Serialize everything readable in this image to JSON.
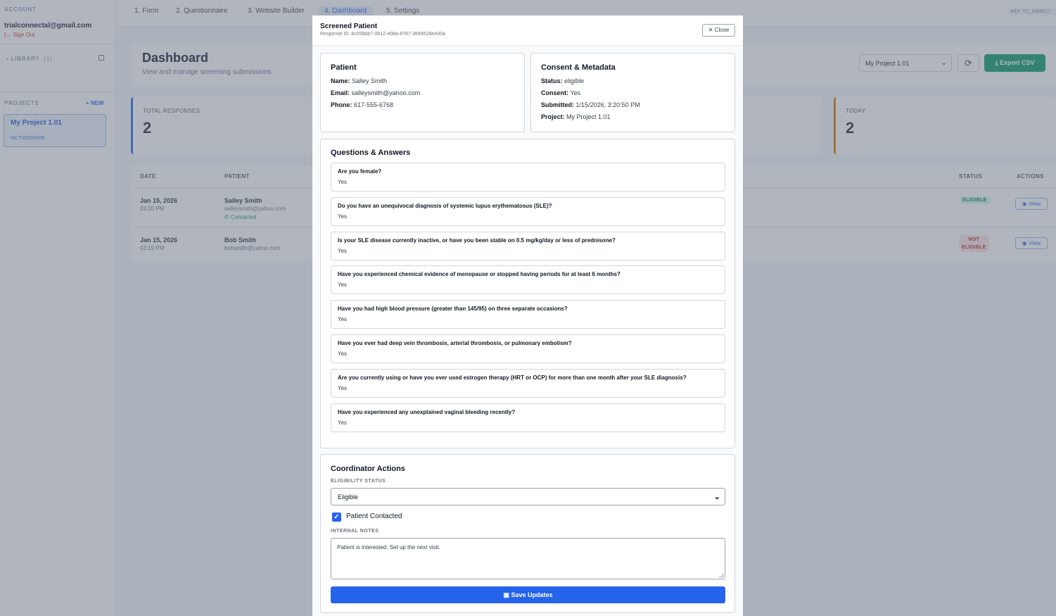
{
  "sidebar": {
    "account_label": "ACCOUNT",
    "email": "trialconnectal@gmail.com",
    "sign_out": "[→ Sign Out",
    "library_label": "LIBRARY",
    "library_count": "(1)",
    "projects_label": "PROJECTS",
    "new_label": "+ NEW",
    "project": {
      "name": "My Project 1.01",
      "id": "NCT00000000"
    }
  },
  "nav": {
    "tabs": [
      "1. Form",
      "2. Questionnaire",
      "3. Website Builder",
      "4. Dashboard",
      "5. Settings"
    ],
    "key": "KEY: TC_2095C17"
  },
  "dashboard": {
    "title": "Dashboard",
    "subtitle": "View and manage screening submissions",
    "project_select": "My Project 1.01",
    "export_label": "Export CSV",
    "stats": [
      {
        "label": "TOTAL RESPONSES",
        "value": "2"
      },
      {
        "label": "TODAY",
        "value": "2"
      }
    ],
    "table": {
      "headers": [
        "DATE",
        "PATIENT",
        "STATUS",
        "ACTIONS"
      ],
      "rows": [
        {
          "date": "Jan 15, 2026",
          "time": "03:20 PM",
          "name": "Salley Smith",
          "email": "salleysmith@yahoo.com",
          "contacted": "Contacted",
          "status": "ELIGIBLE",
          "action": "View"
        },
        {
          "date": "Jan 15, 2026",
          "time": "03:19 PM",
          "name": "Bob Smith",
          "email": "bobsmith@yahoo.com",
          "status_line1": "NOT",
          "status_line2": "ELIGIBLE",
          "action": "View"
        }
      ]
    }
  },
  "modal": {
    "title": "Screened Patient",
    "response_id": "Response ID: 8c55bbb7-0812-408a-8787-369452dee00a",
    "close_label": "Close",
    "patient": {
      "heading": "Patient",
      "name_label": "Name:",
      "name": "Salley Smith",
      "email_label": "Email:",
      "email": "salleysmith@yahoo.com",
      "phone_label": "Phone:",
      "phone": "617-555-6768"
    },
    "consent": {
      "heading": "Consent & Metadata",
      "status_label": "Status:",
      "status": "eligible",
      "consent_label": "Consent:",
      "consent": "Yes",
      "submitted_label": "Submitted:",
      "submitted": "1/15/2026, 3:20:50 PM",
      "project_label": "Project:",
      "project": "My Project 1.01"
    },
    "qa_heading": "Questions & Answers",
    "questions": [
      {
        "q": "Are you female?",
        "a": "Yes"
      },
      {
        "q": "Do you have an unequivocal diagnosis of systemic lupus erythematosus (SLE)?",
        "a": "Yes"
      },
      {
        "q": "Is your SLE disease currently inactive, or have you been stable on 0.5 mg/kg/day or less of prednisone?",
        "a": "Yes"
      },
      {
        "q": "Have you experienced chemical evidence of menopause or stopped having periods for at least 6 months?",
        "a": "Yes"
      },
      {
        "q": "Have you had high blood pressure (greater than 145/95) on three separate occasions?",
        "a": "Yes"
      },
      {
        "q": "Have you ever had deep vein thrombosis, arterial thrombosis, or pulmonary embolism?",
        "a": "Yes"
      },
      {
        "q": "Are you currently using or have you ever used estrogen therapy (HRT or OCP) for more than one month after your SLE diagnosis?",
        "a": "Yes"
      },
      {
        "q": "Have you experienced any unexplained vaginal bleeding recently?",
        "a": "Yes"
      }
    ],
    "coordinator": {
      "heading": "Coordinator Actions",
      "eligibility_label": "ELIGIBILITY STATUS",
      "eligibility_value": "Eligible",
      "contacted_label": "Patient Contacted",
      "notes_label": "INTERNAL NOTES",
      "notes_value": "Patient is interested. Set up the next visit.",
      "save_label": "Save Updates"
    }
  }
}
